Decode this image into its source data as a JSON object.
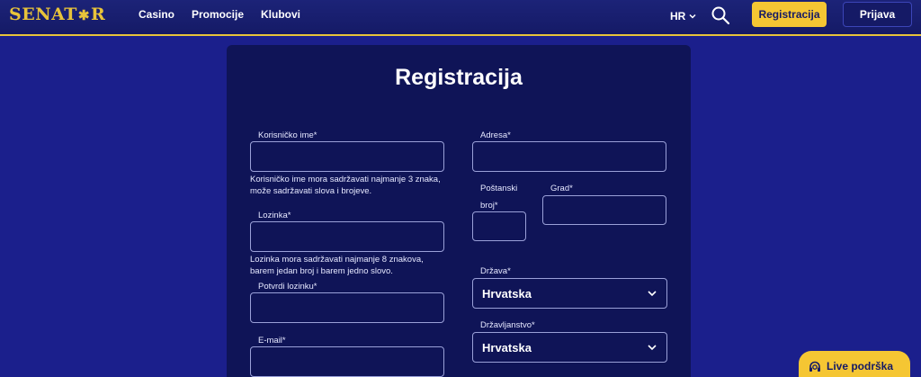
{
  "header": {
    "logo_text": "SENATOR",
    "nav": [
      "Casino",
      "Promocije",
      "Klubovi"
    ],
    "language": "HR",
    "register_label": "Registracija",
    "login_label": "Prijava"
  },
  "form": {
    "title": "Registracija",
    "username": {
      "label": "Korisničko ime*",
      "value": "",
      "helper_line1": "Korisničko ime mora sadržavati najmanje 3 znaka,",
      "helper_line2": "može sadržavati slova i brojeve."
    },
    "password": {
      "label": "Lozinka*",
      "value": "",
      "helper_line1": "Lozinka mora sadržavati najmanje 8 znakova,",
      "helper_line2": "barem jedan broj i barem jedno slovo."
    },
    "confirm_password": {
      "label": "Potvrdi lozinku*",
      "value": ""
    },
    "email": {
      "label": "E-mail*",
      "value": ""
    },
    "address": {
      "label": "Adresa*",
      "value": ""
    },
    "postal_code": {
      "label_line1": "Poštanski",
      "label_line2": "broj*",
      "value": ""
    },
    "city": {
      "label": "Grad*",
      "value": ""
    },
    "country": {
      "label": "Država*",
      "value": "Hrvatska"
    },
    "citizenship": {
      "label": "Državljanstvo*",
      "value": "Hrvatska"
    }
  },
  "live_support": {
    "label": "Live podrška"
  },
  "colors": {
    "background": "#1b1f8c",
    "panel": "#0f1457",
    "accent_gold": "#f5c633",
    "header": "#151a66"
  },
  "icons": {
    "search": "search-icon",
    "chevron": "chevron-down-icon",
    "headset": "headset-icon"
  }
}
